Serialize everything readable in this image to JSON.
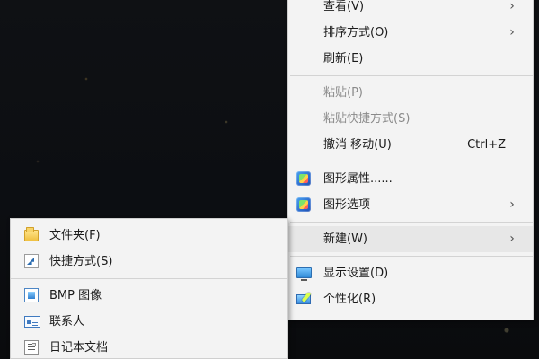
{
  "main_menu": {
    "items": [
      {
        "label": "查看(V)",
        "chevron": "›"
      },
      {
        "label": "排序方式(O)",
        "chevron": "›"
      },
      {
        "label": "刷新(E)"
      },
      {
        "label": "粘贴(P)",
        "disabled": true
      },
      {
        "label": "粘贴快捷方式(S)",
        "disabled": true
      },
      {
        "label": "撤消 移动(U)",
        "shortcut": "Ctrl+Z"
      },
      {
        "label": "图形属性......",
        "icon": "graphics-properties-icon"
      },
      {
        "label": "图形选项",
        "icon": "graphics-options-icon",
        "chevron": "›"
      },
      {
        "label": "新建(W)",
        "chevron": "›",
        "highlighted": true
      },
      {
        "label": "显示设置(D)",
        "icon": "display-settings-icon"
      },
      {
        "label": "个性化(R)",
        "icon": "personalize-icon"
      }
    ]
  },
  "new_submenu": {
    "items": [
      {
        "label": "文件夹(F)",
        "icon": "folder-icon"
      },
      {
        "label": "快捷方式(S)",
        "icon": "shortcut-icon"
      },
      {
        "label": "BMP 图像",
        "icon": "bmp-image-icon"
      },
      {
        "label": "联系人",
        "icon": "contact-icon"
      },
      {
        "label": "日记本文档",
        "icon": "journal-document-icon"
      }
    ]
  },
  "colors": {
    "menu_background": "#f3f3f3",
    "menu_highlight": "#e7e7e7",
    "disabled_text": "#8a8a8a",
    "separator": "#d3d3d3"
  }
}
